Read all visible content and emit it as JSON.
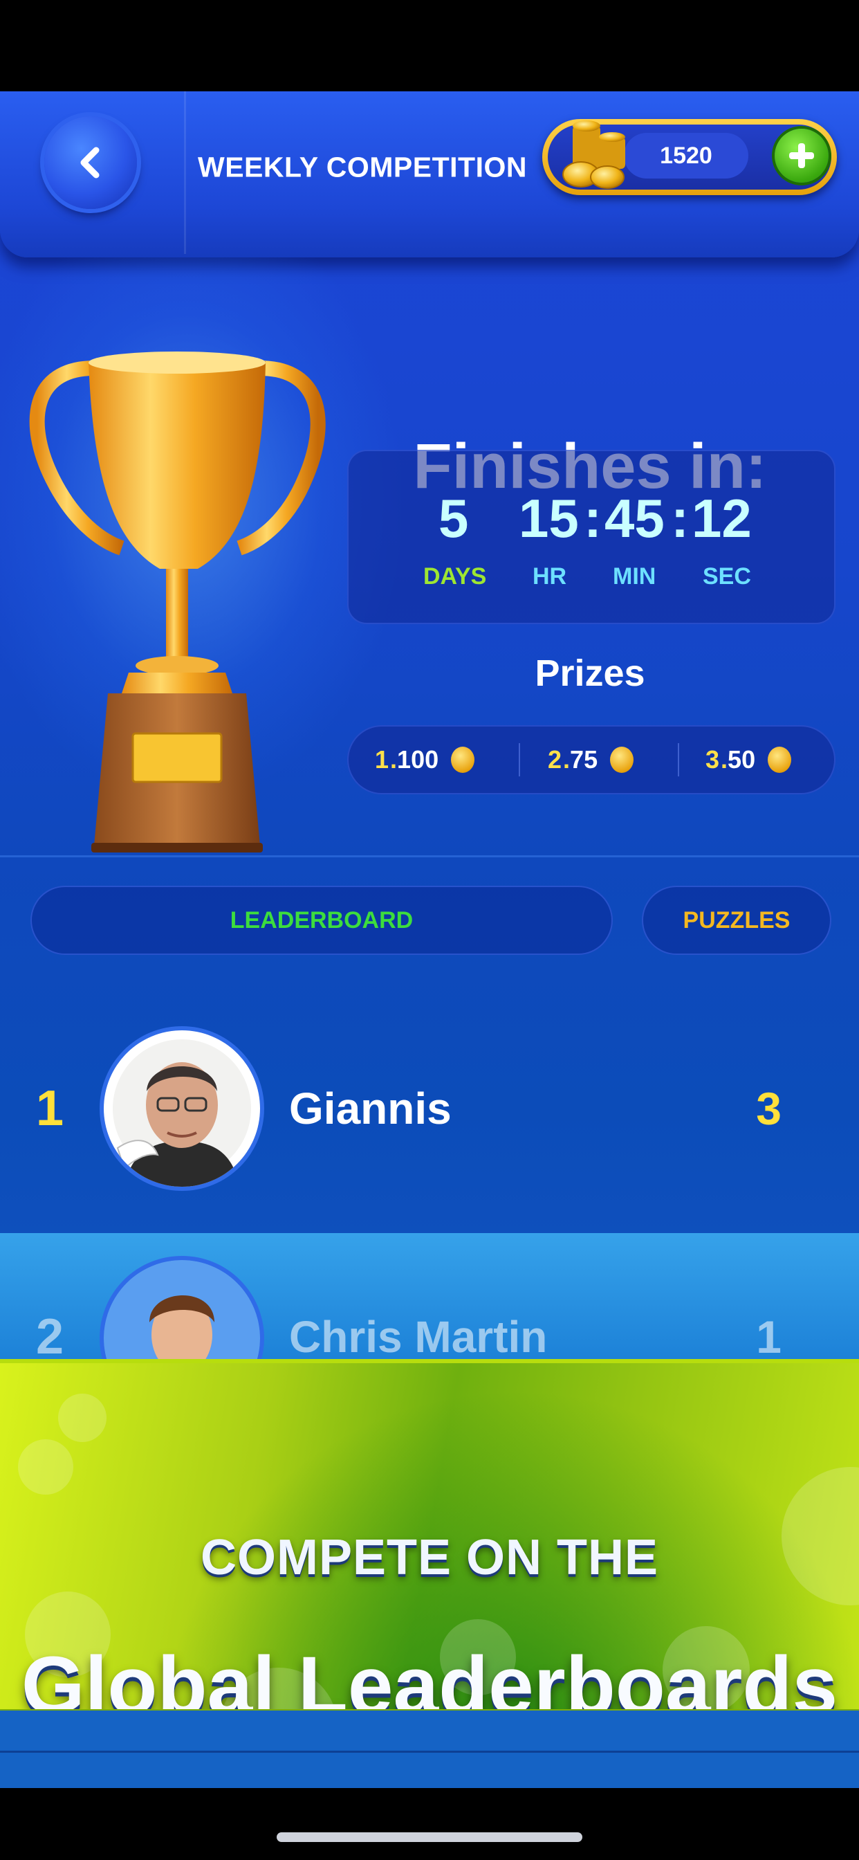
{
  "header": {
    "title": "WEEKLY COMPETITION",
    "coins": "1520"
  },
  "countdown": {
    "title": "Finishes in:",
    "days": "5",
    "hours": "15",
    "minutes": "45",
    "seconds": "12",
    "sep": ":",
    "labels": {
      "days": "DAYS",
      "hours": "HR",
      "minutes": "MIN",
      "seconds": "SEC"
    }
  },
  "prizes": {
    "title": "Prizes",
    "items": [
      {
        "rank": "1",
        "dot": ".",
        "amount": "100"
      },
      {
        "rank": "2",
        "dot": ".",
        "amount": "75"
      },
      {
        "rank": "3",
        "dot": ".",
        "amount": "50"
      }
    ]
  },
  "tabs": {
    "leaderboard": "LEADERBOARD",
    "puzzles": "PUZZLES"
  },
  "leaderboard": [
    {
      "rank": "1",
      "name": "Giannis",
      "score": "3"
    },
    {
      "rank": "2",
      "name": "Chris Martin",
      "score": "1"
    }
  ],
  "banner": {
    "line1": "COMPETE ON THE",
    "line2": "Global Leaderboards"
  },
  "colors": {
    "accent_green": "#3ddd3d",
    "accent_gold": "#f4b820",
    "rank_yellow": "#ffe03a"
  }
}
